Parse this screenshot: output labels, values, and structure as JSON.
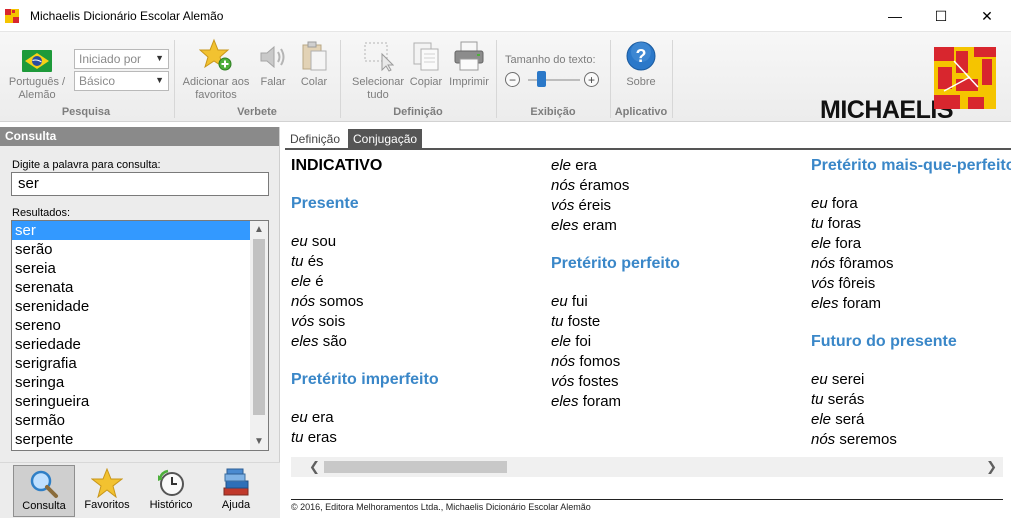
{
  "window": {
    "title": "Michaelis Dicionário Escolar Alemão",
    "controls": {
      "minimize": "—",
      "maximize": "☐",
      "close": "✕"
    }
  },
  "ribbon": {
    "pesquisa": {
      "label": "Pesquisa",
      "language_button": "Português / Alemão",
      "level_combo": {
        "value": "Iniciado por",
        "arrow": "▼"
      },
      "mode_combo": {
        "value": "Básico",
        "arrow": "▼"
      }
    },
    "verbete": {
      "label": "Verbete",
      "add_favorites": "Adicionar aos favoritos",
      "speak": "Falar",
      "paste": "Colar"
    },
    "definicao": {
      "label": "Definição",
      "select_all": "Selecionar tudo",
      "copy": "Copiar",
      "print": "Imprimir"
    },
    "exibicao": {
      "label": "Exibição",
      "text_size_label": "Tamanho do texto:",
      "zoom_out": "−",
      "zoom_in": "+",
      "text_size_level": 0.2
    },
    "aplicativo": {
      "label": "Aplicativo",
      "about": "Sobre",
      "about_icon": "?"
    },
    "logo": "MICHAELIS"
  },
  "consulta": {
    "header": "Consulta",
    "prompt": "Digite a palavra para consulta:",
    "query": "ser",
    "results_label": "Resultados:",
    "results": [
      "ser",
      "serão",
      "sereia",
      "serenata",
      "serenidade",
      "sereno",
      "seriedade",
      "serigrafia",
      "seringa",
      "seringueira",
      "sermão",
      "serpente"
    ],
    "selected_index": 0,
    "scroll_up": "▲",
    "scroll_down": "▼"
  },
  "bottom_tabs": [
    {
      "label": "Consulta",
      "icon": "magnifier-icon",
      "active": true
    },
    {
      "label": "Favoritos",
      "icon": "star-icon",
      "active": false
    },
    {
      "label": "Histórico",
      "icon": "clock-icon",
      "active": false
    },
    {
      "label": "Ajuda",
      "icon": "books-icon",
      "active": false
    }
  ],
  "content": {
    "tabs": [
      {
        "label": "Definição",
        "active": false
      },
      {
        "label": "Conjugação",
        "active": true
      }
    ],
    "heading": "INDICATIVO",
    "presente": {
      "title": "Presente",
      "rows": [
        {
          "p": "eu",
          "v": "sou"
        },
        {
          "p": "tu",
          "v": "és"
        },
        {
          "p": "ele",
          "v": "é"
        },
        {
          "p": "nós",
          "v": "somos"
        },
        {
          "p": "vós",
          "v": "sois"
        },
        {
          "p": "eles",
          "v": "são"
        }
      ]
    },
    "imperfeito": {
      "title": "Pretérito imperfeito",
      "rows": [
        {
          "p": "eu",
          "v": "era"
        },
        {
          "p": "tu",
          "v": "eras"
        },
        {
          "p": "ele",
          "v": "era"
        },
        {
          "p": "nós",
          "v": "éramos"
        },
        {
          "p": "vós",
          "v": "éreis"
        },
        {
          "p": "eles",
          "v": "eram"
        }
      ]
    },
    "perfeito": {
      "title": "Pretérito perfeito",
      "rows": [
        {
          "p": "eu",
          "v": "fui"
        },
        {
          "p": "tu",
          "v": "foste"
        },
        {
          "p": "ele",
          "v": "foi"
        },
        {
          "p": "nós",
          "v": "fomos"
        },
        {
          "p": "vós",
          "v": "fostes"
        },
        {
          "p": "eles",
          "v": "foram"
        }
      ]
    },
    "mais_que_perfeito": {
      "title": "Pretérito mais-que-perfeito",
      "rows": [
        {
          "p": "eu",
          "v": "fora"
        },
        {
          "p": "tu",
          "v": "foras"
        },
        {
          "p": "ele",
          "v": "fora"
        },
        {
          "p": "nós",
          "v": "fôramos"
        },
        {
          "p": "vós",
          "v": "fôreis"
        },
        {
          "p": "eles",
          "v": "foram"
        }
      ]
    },
    "futuro_presente": {
      "title": "Futuro do presente",
      "rows": [
        {
          "p": "eu",
          "v": "serei"
        },
        {
          "p": "tu",
          "v": "serás"
        },
        {
          "p": "ele",
          "v": "será"
        },
        {
          "p": "nós",
          "v": "seremos"
        }
      ]
    },
    "scroll_left": "❮",
    "scroll_right": "❯",
    "footer": "© 2016, Editora Melhoramentos Ltda., Michaelis Dicionário Escolar Alemão"
  },
  "colors": {
    "accent_blue": "#3a87c8",
    "selection": "#3399ff",
    "logo_red": "#d8262e",
    "logo_yellow": "#f5c400"
  }
}
